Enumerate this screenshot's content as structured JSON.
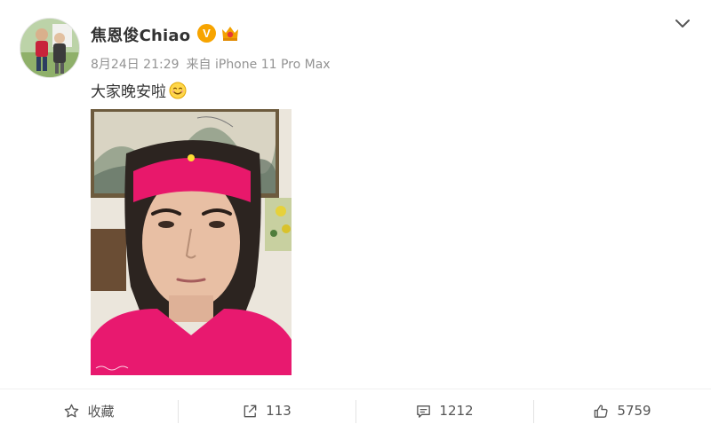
{
  "user": {
    "name": "焦恩俊Chiao",
    "verified_letter": "V"
  },
  "post": {
    "date": "8月24日 21:29",
    "source": "来自 iPhone 11 Pro Max",
    "text": "大家晚安啦"
  },
  "actions": {
    "favorite_label": "收藏",
    "repost_count": "113",
    "comment_count": "1212",
    "like_count": "5759"
  },
  "icons": {
    "verified": "verified-v-badge",
    "vip": "crown-badge",
    "menu": "chevron-down-icon",
    "emoji": "smile-emoji",
    "favorite": "star-icon",
    "repost": "share-arrow-icon",
    "comment": "comment-icon",
    "like": "thumbs-up-icon"
  },
  "colors": {
    "accent_badge": "#f7a400",
    "meta_text": "#939393",
    "headband": "#e8186b",
    "shirt": "#e8196f"
  }
}
